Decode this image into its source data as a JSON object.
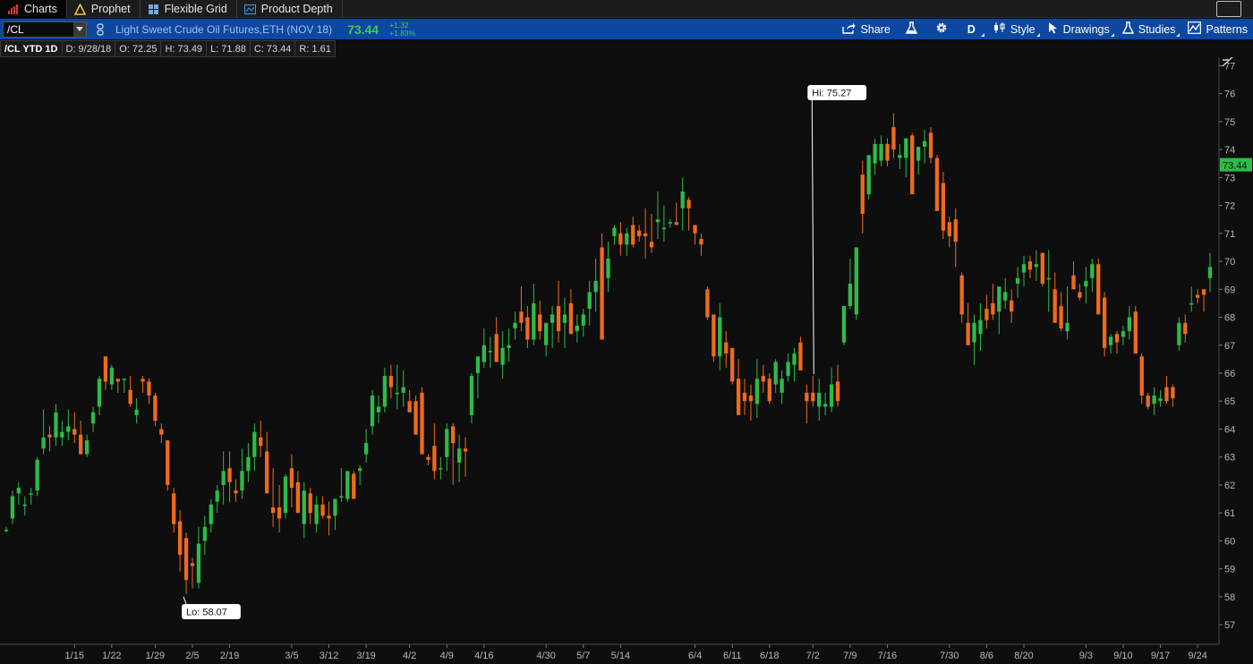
{
  "tabs": [
    {
      "label": "Charts",
      "icon": "bar-chart-icon",
      "active": true
    },
    {
      "label": "Prophet",
      "icon": "warning-triangle-icon",
      "active": false
    },
    {
      "label": "Flexible Grid",
      "icon": "grid-icon",
      "active": false
    },
    {
      "label": "Product Depth",
      "icon": "depth-chart-icon",
      "active": false
    }
  ],
  "toolbar": {
    "symbol": "/CL",
    "description": "Light Sweet Crude Oil Futures,ETH (NOV 18)",
    "last_price": "73.44",
    "change": "+1.32",
    "change_pct": "+1.83%",
    "share_label": "Share",
    "aggregation_label": "D",
    "style_label": "Style",
    "drawings_label": "Drawings",
    "studies_label": "Studies",
    "patterns_label": "Patterns"
  },
  "infobar": {
    "title": "/CL YTD 1D",
    "date": "D: 9/28/18",
    "open": "O: 72.25",
    "high": "H: 73.49",
    "low": "L: 71.88",
    "close": "C: 73.44",
    "range": "R: 1.61"
  },
  "colors": {
    "up": "#2dbb48",
    "down": "#f06a1c",
    "background": "#0e0e0e",
    "toolbar": "#0c47a1",
    "price_tag": "#2dbb48"
  },
  "chart_data": {
    "type": "candlestick",
    "y_ticks": [
      57,
      58,
      59,
      60,
      61,
      62,
      63,
      64,
      65,
      66,
      67,
      68,
      69,
      70,
      71,
      72,
      73,
      74,
      75,
      76,
      77
    ],
    "ylim": [
      56.3,
      77.3
    ],
    "x_tick_labels": [
      "1/15",
      "1/22",
      "1/29",
      "2/5",
      "2/19",
      "3/5",
      "3/12",
      "3/19",
      "4/2",
      "4/9",
      "4/16",
      "4/30",
      "5/7",
      "5/14",
      "6/4",
      "6/11",
      "6/18",
      "7/2",
      "7/9",
      "7/16",
      "7/30",
      "8/6",
      "8/20",
      "9/3",
      "9/10",
      "9/17",
      "9/24"
    ],
    "x_tick_bar_index": [
      11,
      17,
      24,
      30,
      36,
      46,
      52,
      58,
      65,
      71,
      77,
      87,
      93,
      99,
      111,
      117,
      123,
      130,
      136,
      142,
      152,
      158,
      164,
      174,
      180,
      186,
      192
    ],
    "last_price_tag": "73.44",
    "high_label": "Hi: 75.27",
    "low_label": "Lo: 58.07",
    "high_bar_index": 130,
    "low_bar_index": 29,
    "candles": [
      [
        60.4,
        60.5,
        60.3,
        60.4
      ],
      [
        60.8,
        61.8,
        60.6,
        61.6
      ],
      [
        61.7,
        62.1,
        61.3,
        61.9
      ],
      [
        61.3,
        61.6,
        60.9,
        61.3
      ],
      [
        61.7,
        61.9,
        61.3,
        61.7
      ],
      [
        61.8,
        63.0,
        61.6,
        62.9
      ],
      [
        63.3,
        64.7,
        63.1,
        63.7
      ],
      [
        63.8,
        64.1,
        63.2,
        63.7
      ],
      [
        63.7,
        64.9,
        63.4,
        64.6
      ],
      [
        63.7,
        64.3,
        63.4,
        63.9
      ],
      [
        63.9,
        64.7,
        63.6,
        64.1
      ],
      [
        64.0,
        64.6,
        63.5,
        63.8
      ],
      [
        63.8,
        64.3,
        63.1,
        63.1
      ],
      [
        63.1,
        63.8,
        63.0,
        63.6
      ],
      [
        64.2,
        64.8,
        63.9,
        64.6
      ],
      [
        64.8,
        65.9,
        64.5,
        65.8
      ],
      [
        66.6,
        66.6,
        65.4,
        65.7
      ],
      [
        65.6,
        66.3,
        65.4,
        66.2
      ],
      [
        65.8,
        65.8,
        65.3,
        65.7
      ],
      [
        65.8,
        65.8,
        65.3,
        65.8
      ],
      [
        65.4,
        65.9,
        64.8,
        64.9
      ],
      [
        64.5,
        65.1,
        64.2,
        64.7
      ],
      [
        65.8,
        65.9,
        65.3,
        65.7
      ],
      [
        65.7,
        65.8,
        64.9,
        65.2
      ],
      [
        65.2,
        65.3,
        64.1,
        64.3
      ],
      [
        64.0,
        64.2,
        63.5,
        63.8
      ],
      [
        63.6,
        63.6,
        61.8,
        62.0
      ],
      [
        61.7,
        61.9,
        60.3,
        60.6
      ],
      [
        60.7,
        61.1,
        58.9,
        59.5
      ],
      [
        60.1,
        60.3,
        58.1,
        58.6
      ],
      [
        59.2,
        59.4,
        58.3,
        59.1
      ],
      [
        58.5,
        60.5,
        58.3,
        59.9
      ],
      [
        60.0,
        60.9,
        59.5,
        60.5
      ],
      [
        60.6,
        61.5,
        60.3,
        61.3
      ],
      [
        61.4,
        62.0,
        61.0,
        61.8
      ],
      [
        62.0,
        63.2,
        61.3,
        62.5
      ],
      [
        62.6,
        63.2,
        61.4,
        62.1
      ],
      [
        61.8,
        62.2,
        61.4,
        61.7
      ],
      [
        61.8,
        63.3,
        61.5,
        62.5
      ],
      [
        62.5,
        63.5,
        62.1,
        63.0
      ],
      [
        63.0,
        64.2,
        62.5,
        63.9
      ],
      [
        63.7,
        64.3,
        63.0,
        63.4
      ],
      [
        63.2,
        63.9,
        62.8,
        61.7
      ],
      [
        61.2,
        62.6,
        60.5,
        61.0
      ],
      [
        61.2,
        62.0,
        60.3,
        60.8
      ],
      [
        61.0,
        62.4,
        60.8,
        62.3
      ],
      [
        62.6,
        63.1,
        61.2,
        61.9
      ],
      [
        62.1,
        62.5,
        61.0,
        61.0
      ],
      [
        60.6,
        62.1,
        60.1,
        61.8
      ],
      [
        61.7,
        61.9,
        60.6,
        61.0
      ],
      [
        60.6,
        61.6,
        60.3,
        61.3
      ],
      [
        61.3,
        61.6,
        60.8,
        60.9
      ],
      [
        60.9,
        61.4,
        60.2,
        60.8
      ],
      [
        60.9,
        61.5,
        60.4,
        61.5
      ],
      [
        61.6,
        62.6,
        61.4,
        61.6
      ],
      [
        61.5,
        62.4,
        61.4,
        62.5
      ],
      [
        62.4,
        62.5,
        61.6,
        61.5
      ],
      [
        62.5,
        62.7,
        62.0,
        62.6
      ],
      [
        63.1,
        64.0,
        62.8,
        63.5
      ],
      [
        64.1,
        65.4,
        63.8,
        65.2
      ],
      [
        64.6,
        65.2,
        64.2,
        64.8
      ],
      [
        64.8,
        66.2,
        64.6,
        65.9
      ],
      [
        65.9,
        66.3,
        65.1,
        65.5
      ],
      [
        65.3,
        66.3,
        64.7,
        65.3
      ],
      [
        65.3,
        66.1,
        64.8,
        65.5
      ],
      [
        65.0,
        65.4,
        64.6,
        64.6
      ],
      [
        65.0,
        65.2,
        64.3,
        63.8
      ],
      [
        65.3,
        65.5,
        63.5,
        63.1
      ],
      [
        63.0,
        63.1,
        62.7,
        62.9
      ],
      [
        63.4,
        64.2,
        62.2,
        62.5
      ],
      [
        62.6,
        63.0,
        62.2,
        62.6
      ],
      [
        63.0,
        64.2,
        62.5,
        64.0
      ],
      [
        64.1,
        64.2,
        62.0,
        63.5
      ],
      [
        62.8,
        63.8,
        62.1,
        63.3
      ],
      [
        63.3,
        63.7,
        62.3,
        63.2
      ],
      [
        64.5,
        66.0,
        64.2,
        65.9
      ],
      [
        66.0,
        66.5,
        65.1,
        66.6
      ],
      [
        66.4,
        67.6,
        66.2,
        67.0
      ],
      [
        66.8,
        67.3,
        66.2,
        66.8
      ],
      [
        67.4,
        68.0,
        66.8,
        66.4
      ],
      [
        66.3,
        67.5,
        65.8,
        66.9
      ],
      [
        66.9,
        67.6,
        66.4,
        67.0
      ],
      [
        67.6,
        68.2,
        67.2,
        67.8
      ],
      [
        68.2,
        69.1,
        67.5,
        67.8
      ],
      [
        68.0,
        68.4,
        66.9,
        67.2
      ],
      [
        67.2,
        69.2,
        67.0,
        68.5
      ],
      [
        68.1,
        68.6,
        67.2,
        67.5
      ],
      [
        67.0,
        67.8,
        66.6,
        67.8
      ],
      [
        67.8,
        68.4,
        66.9,
        68.1
      ],
      [
        68.4,
        69.3,
        67.1,
        67.5
      ],
      [
        67.8,
        68.7,
        66.9,
        68.1
      ],
      [
        68.5,
        69.0,
        67.5,
        67.4
      ],
      [
        67.5,
        68.1,
        67.1,
        67.7
      ],
      [
        67.7,
        68.3,
        67.3,
        68.1
      ],
      [
        68.3,
        69.3,
        67.7,
        68.9
      ],
      [
        68.9,
        70.1,
        68.2,
        69.3
      ],
      [
        70.5,
        71.0,
        68.1,
        67.2
      ],
      [
        69.4,
        70.7,
        68.9,
        70.1
      ],
      [
        70.9,
        71.3,
        70.6,
        71.2
      ],
      [
        71.0,
        71.4,
        70.2,
        70.6
      ],
      [
        70.6,
        71.2,
        70.2,
        71.0
      ],
      [
        71.3,
        71.6,
        70.5,
        70.6
      ],
      [
        71.1,
        71.3,
        70.7,
        70.9
      ],
      [
        71.0,
        71.9,
        70.1,
        70.9
      ],
      [
        70.7,
        71.7,
        70.3,
        70.5
      ],
      [
        71.4,
        72.5,
        70.8,
        71.5
      ],
      [
        71.2,
        72.0,
        70.7,
        71.2
      ],
      [
        71.4,
        71.5,
        71.2,
        71.4
      ],
      [
        71.4,
        72.1,
        71.4,
        71.3
      ],
      [
        71.9,
        73.0,
        71.1,
        72.5
      ],
      [
        72.2,
        72.3,
        71.1,
        71.9
      ],
      [
        71.3,
        71.3,
        70.6,
        71.0
      ],
      [
        70.8,
        71.0,
        70.2,
        70.6
      ],
      [
        69.0,
        69.1,
        67.9,
        68.0
      ],
      [
        68.1,
        68.1,
        66.4,
        66.6
      ],
      [
        66.6,
        68.5,
        66.1,
        68.0
      ],
      [
        67.1,
        67.5,
        66.2,
        66.7
      ],
      [
        66.9,
        66.9,
        65.6,
        65.7
      ],
      [
        65.8,
        66.5,
        64.9,
        64.5
      ],
      [
        65.3,
        65.8,
        64.5,
        65.0
      ],
      [
        65.2,
        65.6,
        64.3,
        65.0
      ],
      [
        64.9,
        66.5,
        64.4,
        65.8
      ],
      [
        65.9,
        66.3,
        65.3,
        65.7
      ],
      [
        65.8,
        66.0,
        64.9,
        65.0
      ],
      [
        65.6,
        66.5,
        65.3,
        66.4
      ],
      [
        65.3,
        66.1,
        64.9,
        65.8
      ],
      [
        65.9,
        66.7,
        65.7,
        66.4
      ],
      [
        66.3,
        66.9,
        65.7,
        66.7
      ],
      [
        67.1,
        67.3,
        66.1,
        66.1
      ],
      [
        65.3,
        65.6,
        64.2,
        65.0
      ],
      [
        65.3,
        65.9,
        64.8,
        65.0
      ],
      [
        64.8,
        65.8,
        64.3,
        65.3
      ],
      [
        64.8,
        65.3,
        64.5,
        64.9
      ],
      [
        64.8,
        66.2,
        64.6,
        65.6
      ],
      [
        65.7,
        66.3,
        64.8,
        65.0
      ],
      [
        67.1,
        68.0,
        67.0,
        68.4
      ],
      [
        68.4,
        70.1,
        68.3,
        69.2
      ],
      [
        68.1,
        70.4,
        67.9,
        70.5
      ],
      [
        73.1,
        73.6,
        71.0,
        71.7
      ],
      [
        72.4,
        73.5,
        72.2,
        73.8
      ],
      [
        73.5,
        74.4,
        73.1,
        74.2
      ],
      [
        73.6,
        74.5,
        73.4,
        74.2
      ],
      [
        74.2,
        74.4,
        73.4,
        73.6
      ],
      [
        74.8,
        75.3,
        73.7,
        74.0
      ],
      [
        73.7,
        74.2,
        73.3,
        73.8
      ],
      [
        73.7,
        74.0,
        73.0,
        74.4
      ],
      [
        74.5,
        74.6,
        72.7,
        72.4
      ],
      [
        73.6,
        74.1,
        73.1,
        74.1
      ],
      [
        74.1,
        74.7,
        73.5,
        74.3
      ],
      [
        74.6,
        74.8,
        73.5,
        73.7
      ],
      [
        73.7,
        73.8,
        72.6,
        71.8
      ],
      [
        72.8,
        73.2,
        70.8,
        71.1
      ],
      [
        71.4,
        71.6,
        70.5,
        70.9
      ],
      [
        71.5,
        71.9,
        69.8,
        70.7
      ],
      [
        69.5,
        69.6,
        67.8,
        68.1
      ],
      [
        67.8,
        68.5,
        67.0,
        67.0
      ],
      [
        67.1,
        68.1,
        66.3,
        67.8
      ],
      [
        67.4,
        68.5,
        66.8,
        67.9
      ],
      [
        68.3,
        68.8,
        67.6,
        67.9
      ],
      [
        68.5,
        69.2,
        67.9,
        68.1
      ],
      [
        68.2,
        68.9,
        67.4,
        69.1
      ],
      [
        68.6,
        69.4,
        68.3,
        68.9
      ],
      [
        68.6,
        69.0,
        67.8,
        68.2
      ],
      [
        69.2,
        69.8,
        68.7,
        69.4
      ],
      [
        69.6,
        70.2,
        69.1,
        69.9
      ],
      [
        70.0,
        70.2,
        69.4,
        69.7
      ],
      [
        69.8,
        70.4,
        69.3,
        69.9
      ],
      [
        70.3,
        70.3,
        69.1,
        69.2
      ],
      [
        69.4,
        70.4,
        68.2,
        69.4
      ],
      [
        69.0,
        69.6,
        68.1,
        67.8
      ],
      [
        68.4,
        68.9,
        67.5,
        67.6
      ],
      [
        67.5,
        69.1,
        67.2,
        67.8
      ],
      [
        69.5,
        70.0,
        69.0,
        69.0
      ],
      [
        68.9,
        69.2,
        68.6,
        68.7
      ],
      [
        69.1,
        69.8,
        68.5,
        69.3
      ],
      [
        69.4,
        70.1,
        68.9,
        69.9
      ],
      [
        69.9,
        70.1,
        68.1,
        68.1
      ],
      [
        68.7,
        68.9,
        66.6,
        66.9
      ],
      [
        67.0,
        67.4,
        66.7,
        67.3
      ],
      [
        67.4,
        67.5,
        66.7,
        67.1
      ],
      [
        67.3,
        67.7,
        67.0,
        67.5
      ],
      [
        67.5,
        68.4,
        67.2,
        68.0
      ],
      [
        68.2,
        68.4,
        67.1,
        66.7
      ],
      [
        66.6,
        66.7,
        64.9,
        65.2
      ],
      [
        65.2,
        65.3,
        64.7,
        64.8
      ],
      [
        64.9,
        65.5,
        64.5,
        65.2
      ],
      [
        65.0,
        65.4,
        64.8,
        65.1
      ],
      [
        65.5,
        65.9,
        64.9,
        65.0
      ],
      [
        65.5,
        65.6,
        64.8,
        65.1
      ],
      [
        67.0,
        68.0,
        66.8,
        67.8
      ],
      [
        67.8,
        68.1,
        67.1,
        67.4
      ],
      [
        68.5,
        69.1,
        68.2,
        68.5
      ],
      [
        68.8,
        69.0,
        68.5,
        68.7
      ],
      [
        69.0,
        69.0,
        68.2,
        68.8
      ],
      [
        69.4,
        70.3,
        68.9,
        69.8
      ]
    ]
  }
}
